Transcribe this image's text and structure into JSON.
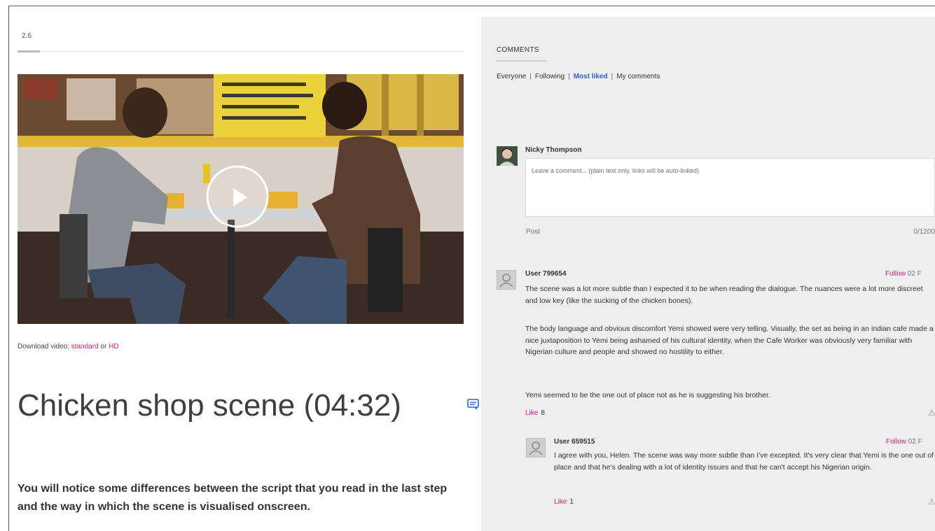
{
  "step": {
    "number": "2.6"
  },
  "video": {
    "play_icon": "play-icon"
  },
  "download": {
    "label": "Download video:",
    "standard": "standard",
    "or": "or",
    "hd": "HD"
  },
  "article": {
    "title": "Chicken shop scene (04:32)",
    "intro": "You will notice some differences between the script that you read in the last step and the way in which the scene is visualised onscreen."
  },
  "comments": {
    "heading": "COMMENTS",
    "filters": [
      {
        "label": "Everyone"
      },
      {
        "label": "Following"
      },
      {
        "label": "Most liked"
      },
      {
        "label": "My comments"
      }
    ],
    "composer": {
      "name": "Nicky Thompson",
      "placeholder": "Leave a comment... (plain text only, links will be auto-linked)",
      "post_label": "Post",
      "char_count": "0/1200"
    },
    "items": [
      {
        "user": "User 799654",
        "follow": "Follow",
        "date": "02 F",
        "paragraphs": [
          "The scene was a lot more subtle than I expected it to be when reading the dialogue. The nuances were a lot more discreet and low key (like the sucking of the chicken bones).",
          "The body language and obvious discomfort Yemi showed were very telling. Visually, the set as being in an indian cafe made a nice juxtaposition to Yemi being ashamed of his cultural identity, when the Cafe Worker was obviously very familiar with Nigerian culture and people and showed no hostility to either.",
          "Yemi seemed to be the one out of place not as he is suggesting his brother."
        ],
        "like_label": "Like",
        "like_count": "8"
      },
      {
        "user": "User 659515",
        "follow": "Follow",
        "date": "02 F",
        "paragraphs": [
          "I agree with you, Helen. The scene was way more subtle than I've excepted. It's very clear that Yemi is the one out of place and that he's dealing with a lot of identity issues and that he can't accept his Nigerian origin."
        ],
        "like_label": "Like",
        "like_count": "1"
      }
    ]
  },
  "colors": {
    "accent": "#d6197b",
    "active_filter": "#2b63d6",
    "panel_bg": "#eeeeee"
  }
}
